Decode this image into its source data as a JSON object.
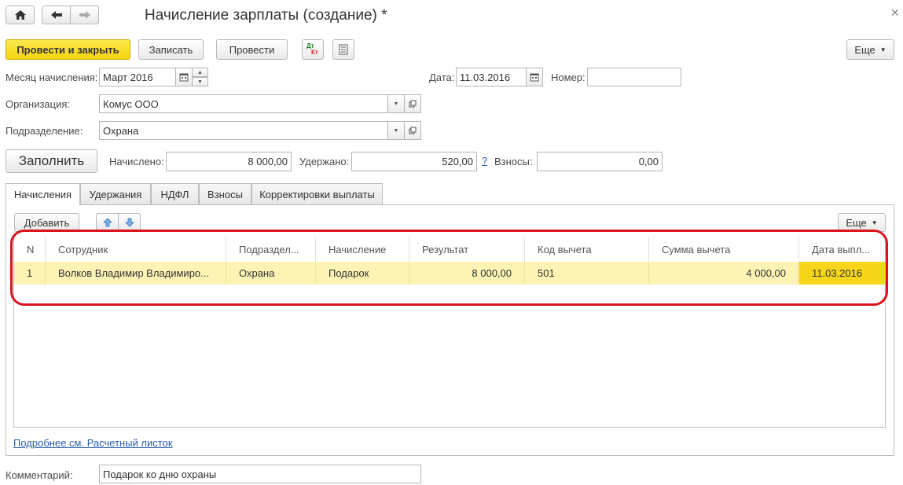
{
  "title": "Начисление зарплаты (создание) *",
  "toolbar": {
    "post_close": "Провести и закрыть",
    "save": "Записать",
    "post": "Провести",
    "dtkt_top": "Дт",
    "dtkt_bottom": "Кт",
    "more": "Еще"
  },
  "form": {
    "month_label": "Месяц начисления:",
    "month_value": "Март 2016",
    "date_label": "Дата:",
    "date_value": "11.03.2016",
    "number_label": "Номер:",
    "number_value": "",
    "org_label": "Организация:",
    "org_value": "Комус ООО",
    "dept_label": "Подразделение:",
    "dept_value": "Охрана",
    "fill_button": "Заполнить",
    "accrued_label": "Начислено:",
    "accrued_value": "8 000,00",
    "withheld_label": "Удержано:",
    "withheld_value": "520,00",
    "help_mark": "?",
    "contrib_label": "Взносы:",
    "contrib_value": "0,00",
    "comment_label": "Комментарий:",
    "comment_value": "Подарок ко дню охраны"
  },
  "tabs": [
    "Начисления",
    "Удержания",
    "НДФЛ",
    "Взносы",
    "Корректировки выплаты"
  ],
  "table_toolbar": {
    "add": "Добавить",
    "more": "Еще"
  },
  "table": {
    "columns": [
      "N",
      "Сотрудник",
      "Подраздел...",
      "Начисление",
      "Результат",
      "Код вычета",
      "Сумма вычета",
      "Дата выпл..."
    ],
    "rows": [
      [
        "1",
        "Волков Владимир Владимиро...",
        "Охрана",
        "Подарок",
        "8 000,00",
        "501",
        "4 000,00",
        "11.03.2016"
      ]
    ]
  },
  "link": "Подробнее см. Расчетный листок",
  "colors": {
    "accent_yellow": "#f5d40f",
    "row_highlight": "#fdf3b4",
    "cell_highlight": "#f7d51a",
    "annotation_red": "#d9141c",
    "link_blue": "#2a5db0"
  }
}
